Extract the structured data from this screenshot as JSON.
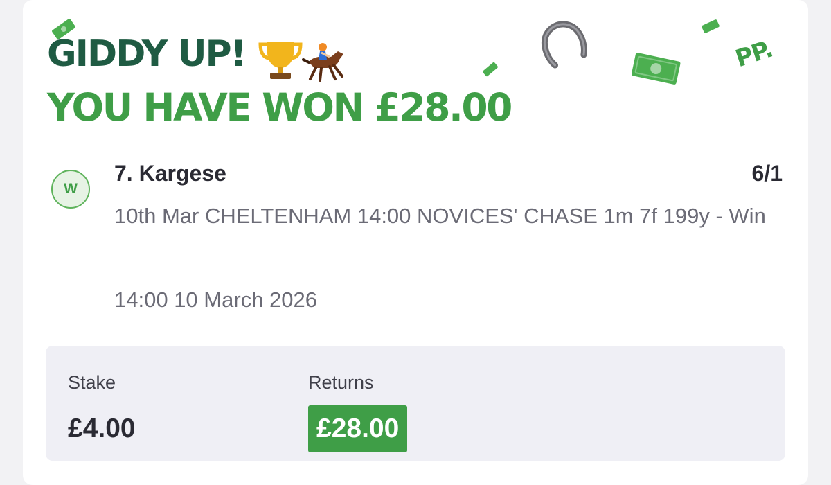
{
  "banner": {
    "line1": "GIDDY UP! ",
    "line2": "YOU HAVE WON £28.00",
    "emoji": [
      "🏆",
      "🏇"
    ],
    "decor_text": "PP."
  },
  "bet": {
    "status_letter": "W",
    "selection": "7. Kargese",
    "odds": "6/1",
    "market": "10th Mar CHELTENHAM 14:00 NOVICES' CHASE 1m 7f 199y - Win",
    "event_time": "14:00 10 March 2026"
  },
  "summary": {
    "stake_label": "Stake",
    "stake_value": "£4.00",
    "returns_label": "Returns",
    "returns_value": "£28.00"
  },
  "colors": {
    "dark_green": "#1f5b43",
    "brand_green": "#3f9e47",
    "cash_green": "#4caf50"
  },
  "icons": [
    "trophy-icon",
    "horse-racing-icon",
    "horseshoe-icon",
    "banknote-icon"
  ]
}
